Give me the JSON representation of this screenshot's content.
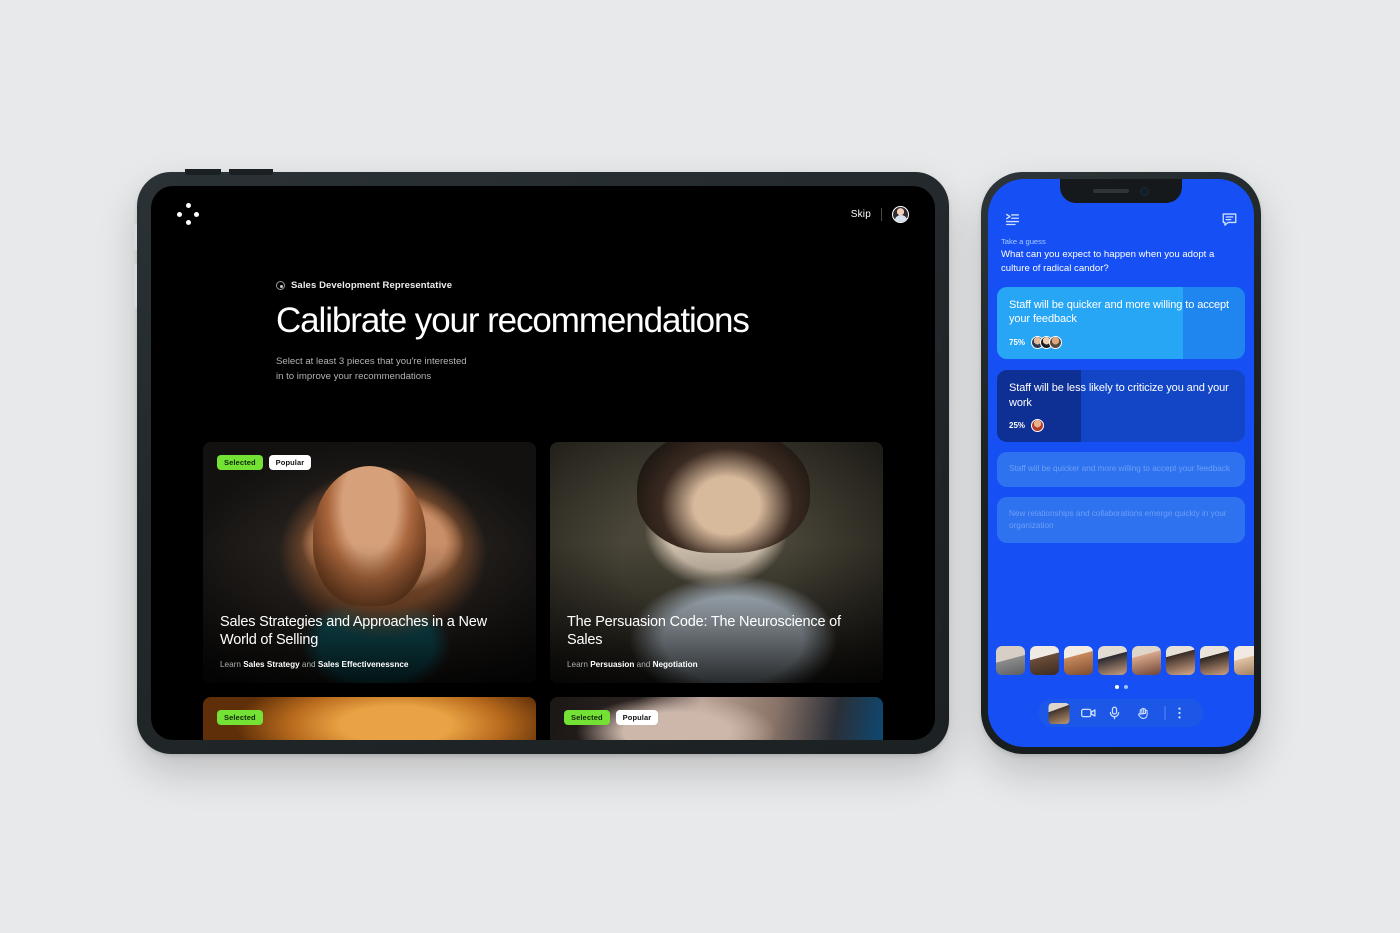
{
  "tablet": {
    "topbar": {
      "logo": "four-dots-logo",
      "skip_label": "Skip",
      "avatar": "user-avatar"
    },
    "hero": {
      "eyebrow": "Sales Development Representative",
      "title": "Calibrate your recommendations",
      "subtitle": "Select at least 3 pieces that you're interested in to improve your recommendations"
    },
    "badge_labels": {
      "selected": "Selected",
      "popular": "Popular"
    },
    "cards": [
      {
        "badges": [
          "Selected",
          "Popular"
        ],
        "title": "Sales Strategies and Approaches in a New World of Selling",
        "meta_prefix": "Learn ",
        "meta_topic_1": "Sales Strategy",
        "meta_join": " and ",
        "meta_topic_2": "Sales Effectivenessnce"
      },
      {
        "badges": [],
        "title": "The Persuasion Code: The Neuroscience of Sales",
        "meta_prefix": "Learn ",
        "meta_topic_1": "Persuasion",
        "meta_join": " and ",
        "meta_topic_2": "Negotiation"
      },
      {
        "badges": [
          "Selected"
        ],
        "title": "",
        "meta_prefix": "",
        "meta_topic_1": "",
        "meta_join": "",
        "meta_topic_2": ""
      },
      {
        "badges": [
          "Selected",
          "Popular"
        ],
        "title": "",
        "meta_prefix": "",
        "meta_topic_1": "",
        "meta_join": "",
        "meta_topic_2": ""
      }
    ]
  },
  "phone": {
    "topbar": {
      "left_icon": "playlist-menu-icon",
      "right_icon": "chat-bubble-icon"
    },
    "poll": {
      "eyebrow": "Take a guess",
      "question": "What can you expect to happen when you adopt a culture of radical candor?",
      "options": [
        {
          "label": "Staff will be quicker and more willing to accept your feedback",
          "percent": "75%",
          "voters": 3,
          "state": "leading"
        },
        {
          "label": "Staff will be less likely to criticize you and your work",
          "percent": "25%",
          "voters": 1,
          "state": "second"
        },
        {
          "label": "Staff will be quicker and more willing to accept your feedback",
          "percent": "",
          "voters": 0,
          "state": "dimmed"
        },
        {
          "label": "New relationships and collaborations emerge quickly in your organization",
          "percent": "",
          "voters": 0,
          "state": "dimmed"
        }
      ]
    },
    "participants": [
      "p1",
      "p2",
      "p3",
      "p4",
      "p5",
      "p6",
      "p7",
      "p8"
    ],
    "pagination": {
      "pages": 2,
      "active": 0
    },
    "controlbar": {
      "self_tile": "self-video-tile",
      "camera_icon": "video-camera-icon",
      "mic_icon": "microphone-icon",
      "hand_icon": "raise-hand-icon",
      "more_icon": "more-options-icon"
    }
  },
  "colors": {
    "page_bg": "#e8e9ea",
    "tablet_screen": "#000000",
    "phone_accent": "#1650f5",
    "badge_selected": "#74e234",
    "badge_popular": "#ffffff",
    "option_leading": "#27a6f5",
    "option_second": "#0e2f93"
  }
}
